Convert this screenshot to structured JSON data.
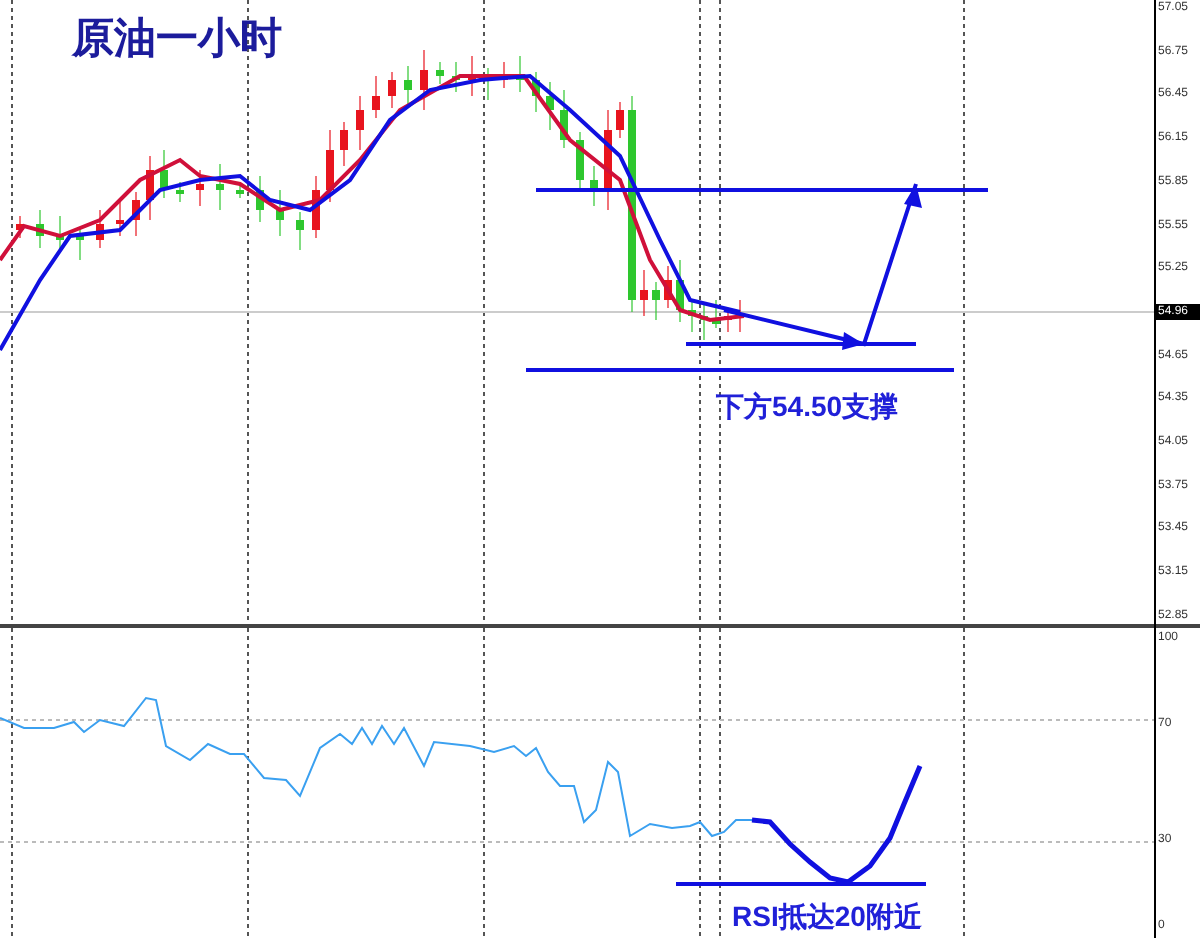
{
  "title": "原油一小时",
  "price_axis": {
    "ticks": [
      {
        "label": "57.05",
        "current": false
      },
      {
        "label": "56.75",
        "current": false
      },
      {
        "label": "56.45",
        "current": false
      },
      {
        "label": "56.15",
        "current": false
      },
      {
        "label": "55.85",
        "current": false
      },
      {
        "label": "55.55",
        "current": false
      },
      {
        "label": "55.25",
        "current": false
      },
      {
        "label": "54.96",
        "current": true
      },
      {
        "label": "54.65",
        "current": false
      },
      {
        "label": "54.35",
        "current": false
      },
      {
        "label": "54.05",
        "current": false
      },
      {
        "label": "53.75",
        "current": false
      },
      {
        "label": "53.45",
        "current": false
      },
      {
        "label": "53.15",
        "current": false
      },
      {
        "label": "52.85",
        "current": false
      }
    ]
  },
  "price_annotation": "下方54.50支撑",
  "rsi_panel": {
    "ticks": [
      "100",
      "70",
      "30",
      "0"
    ],
    "annotation": "RSI抵达20附近"
  }
}
